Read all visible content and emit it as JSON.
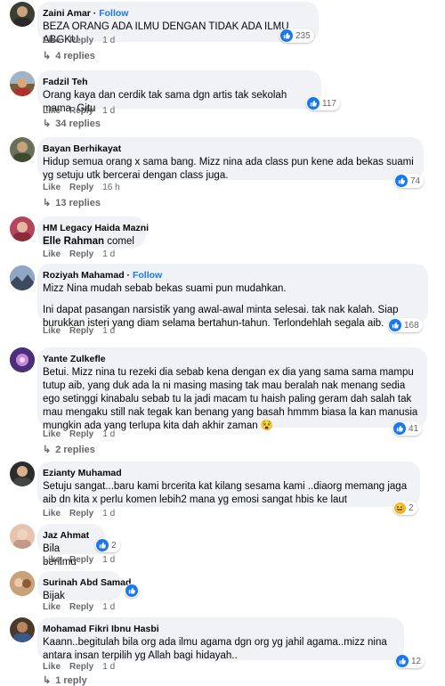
{
  "labels": {
    "like": "Like",
    "reply": "Reply",
    "follow": "Follow",
    "follow_sep": " · "
  },
  "comments": [
    {
      "name": "Zaini Amar",
      "follow": true,
      "text": [
        "BEZA ORANG ADA ILMU DENGAN TIDAK ADA ILMU ABGKU"
      ],
      "time": "1 d",
      "reaction_count": "235",
      "replies": "4 replies"
    },
    {
      "name": "Fadzil Teh",
      "text": [
        "Orang kaya dan cerdik tak sama dgn artis tak sekolah mama. Gitu"
      ],
      "time": "1 d",
      "reaction_count": "117",
      "replies": "34 replies"
    },
    {
      "name": "Bayan Berhikayat",
      "text": [
        "Hidup semua orang x sama bang. Mizz nina ada class pun kene ada bekas suami yg setuju utk bercerai dengan class juga."
      ],
      "time": "16 h",
      "reaction_count": "74",
      "replies": "13 replies"
    },
    {
      "name": "HM Legacy Haida Mazni",
      "mention": "Elle Rahman",
      "text": [
        "comel"
      ],
      "time": "1 d"
    },
    {
      "name": "Roziyah Mahamad",
      "follow": true,
      "text": [
        "Mizz Nina mudah sebab bekas suami pun mudahkan.",
        "Ini dapat pasangan narsistik yang awal-awal minta selesai. tak nak kalah. Siap burukkan isteri yang diam selama bertahun-tahun. Terlondehlah segala aib."
      ],
      "time": "1 d",
      "reaction_count": "168"
    },
    {
      "name": "Yante Zulkefle",
      "text": [
        "Betui. Mizz nina tu rezeki dia sebab kena dengan ex dia yang sama sama mampu tutup aib, yang duk ada la ni masing masing tak mau beralah nak menang sedia ego setinggi kinabalu sebab tu la jadi macam tu haish paling geram dah salah tak mau mengaku still nak tegak kan benang yang basah hmmm biasa la kan manusia mungkin ada yang terlupa kita dah akhir zaman 😵"
      ],
      "time": "1 d",
      "reaction_count": "41",
      "replies": "2 replies"
    },
    {
      "name": "Ezianty Muhamad",
      "text": [
        "Setuju sangat...baru kami brcerita kat kilang sesama kami ..diaorg memang jaga aib dn kita x perlu komen lebih2 mana yg emosi sangat hbis ke laut"
      ],
      "time": "1 d",
      "reaction_count": "2"
    },
    {
      "name": "Jaz Ahmat",
      "text": [
        "Bila berilmu"
      ],
      "time": "1 d",
      "reaction_count": "2"
    },
    {
      "name": "Surinah Abd Samad",
      "text": [
        "Bijak"
      ],
      "time": "1 d"
    },
    {
      "name": "Mohamad Fikri Ibnu Hasbi",
      "text": [
        "Kaann..begitulah bila org ada ilmu agama dgn org yg jahil agama..mizz nina antara insan terpilih yg Allah bagi hidayah.."
      ],
      "time": "1 d",
      "reaction_count": "12",
      "replies": "1 reply"
    }
  ]
}
